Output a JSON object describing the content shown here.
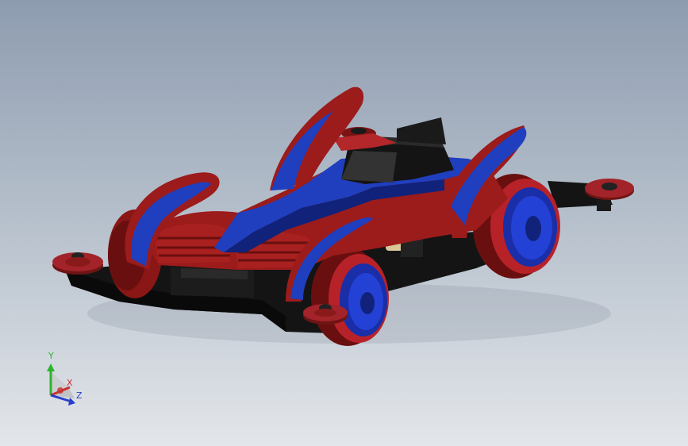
{
  "viewport": {
    "background_top": "#8e9cb0",
    "background_bottom": "#e3e6ea"
  },
  "model": {
    "icon": "race-car-3d-model",
    "colors": {
      "body_red": "#9c1b1b",
      "body_red_dark": "#5e0d0d",
      "body_blue": "#1f3fbf",
      "body_blue_dark": "#10227a",
      "chassis_black": "#141414",
      "roller_red": "#a3232a"
    }
  },
  "triad": {
    "icon": "coordinate-axis-triad-icon",
    "y_label": "Y",
    "x_label": "X",
    "z_label": "Z",
    "colors": {
      "y": "#2bb52b",
      "x": "#c83232",
      "z": "#2a3fc8"
    }
  }
}
